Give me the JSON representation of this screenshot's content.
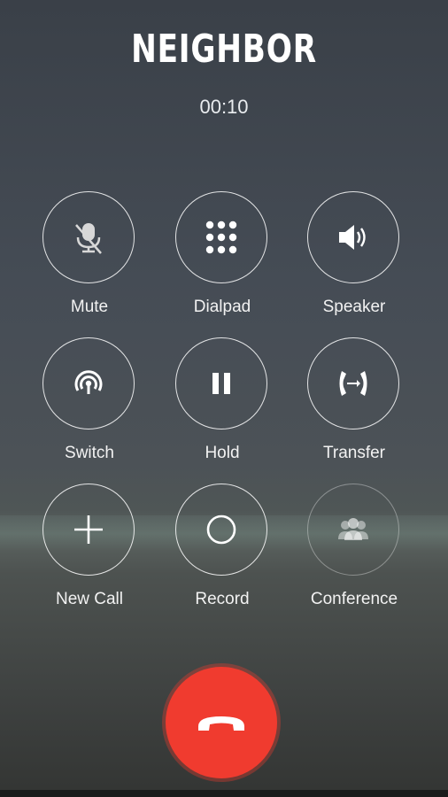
{
  "call": {
    "caller_name": "NEIGHBOR",
    "duration": "00:10"
  },
  "controls": [
    {
      "label": "Mute",
      "icon": "mic-off-icon"
    },
    {
      "label": "Dialpad",
      "icon": "dialpad-icon"
    },
    {
      "label": "Speaker",
      "icon": "speaker-icon"
    },
    {
      "label": "Switch",
      "icon": "switch-icon"
    },
    {
      "label": "Hold",
      "icon": "pause-icon"
    },
    {
      "label": "Transfer",
      "icon": "transfer-icon"
    },
    {
      "label": "New Call",
      "icon": "plus-icon"
    },
    {
      "label": "Record",
      "icon": "record-icon"
    },
    {
      "label": "Conference",
      "icon": "conference-icon"
    }
  ],
  "end_call": {
    "icon": "end-call-icon",
    "color": "#f03b2f"
  }
}
